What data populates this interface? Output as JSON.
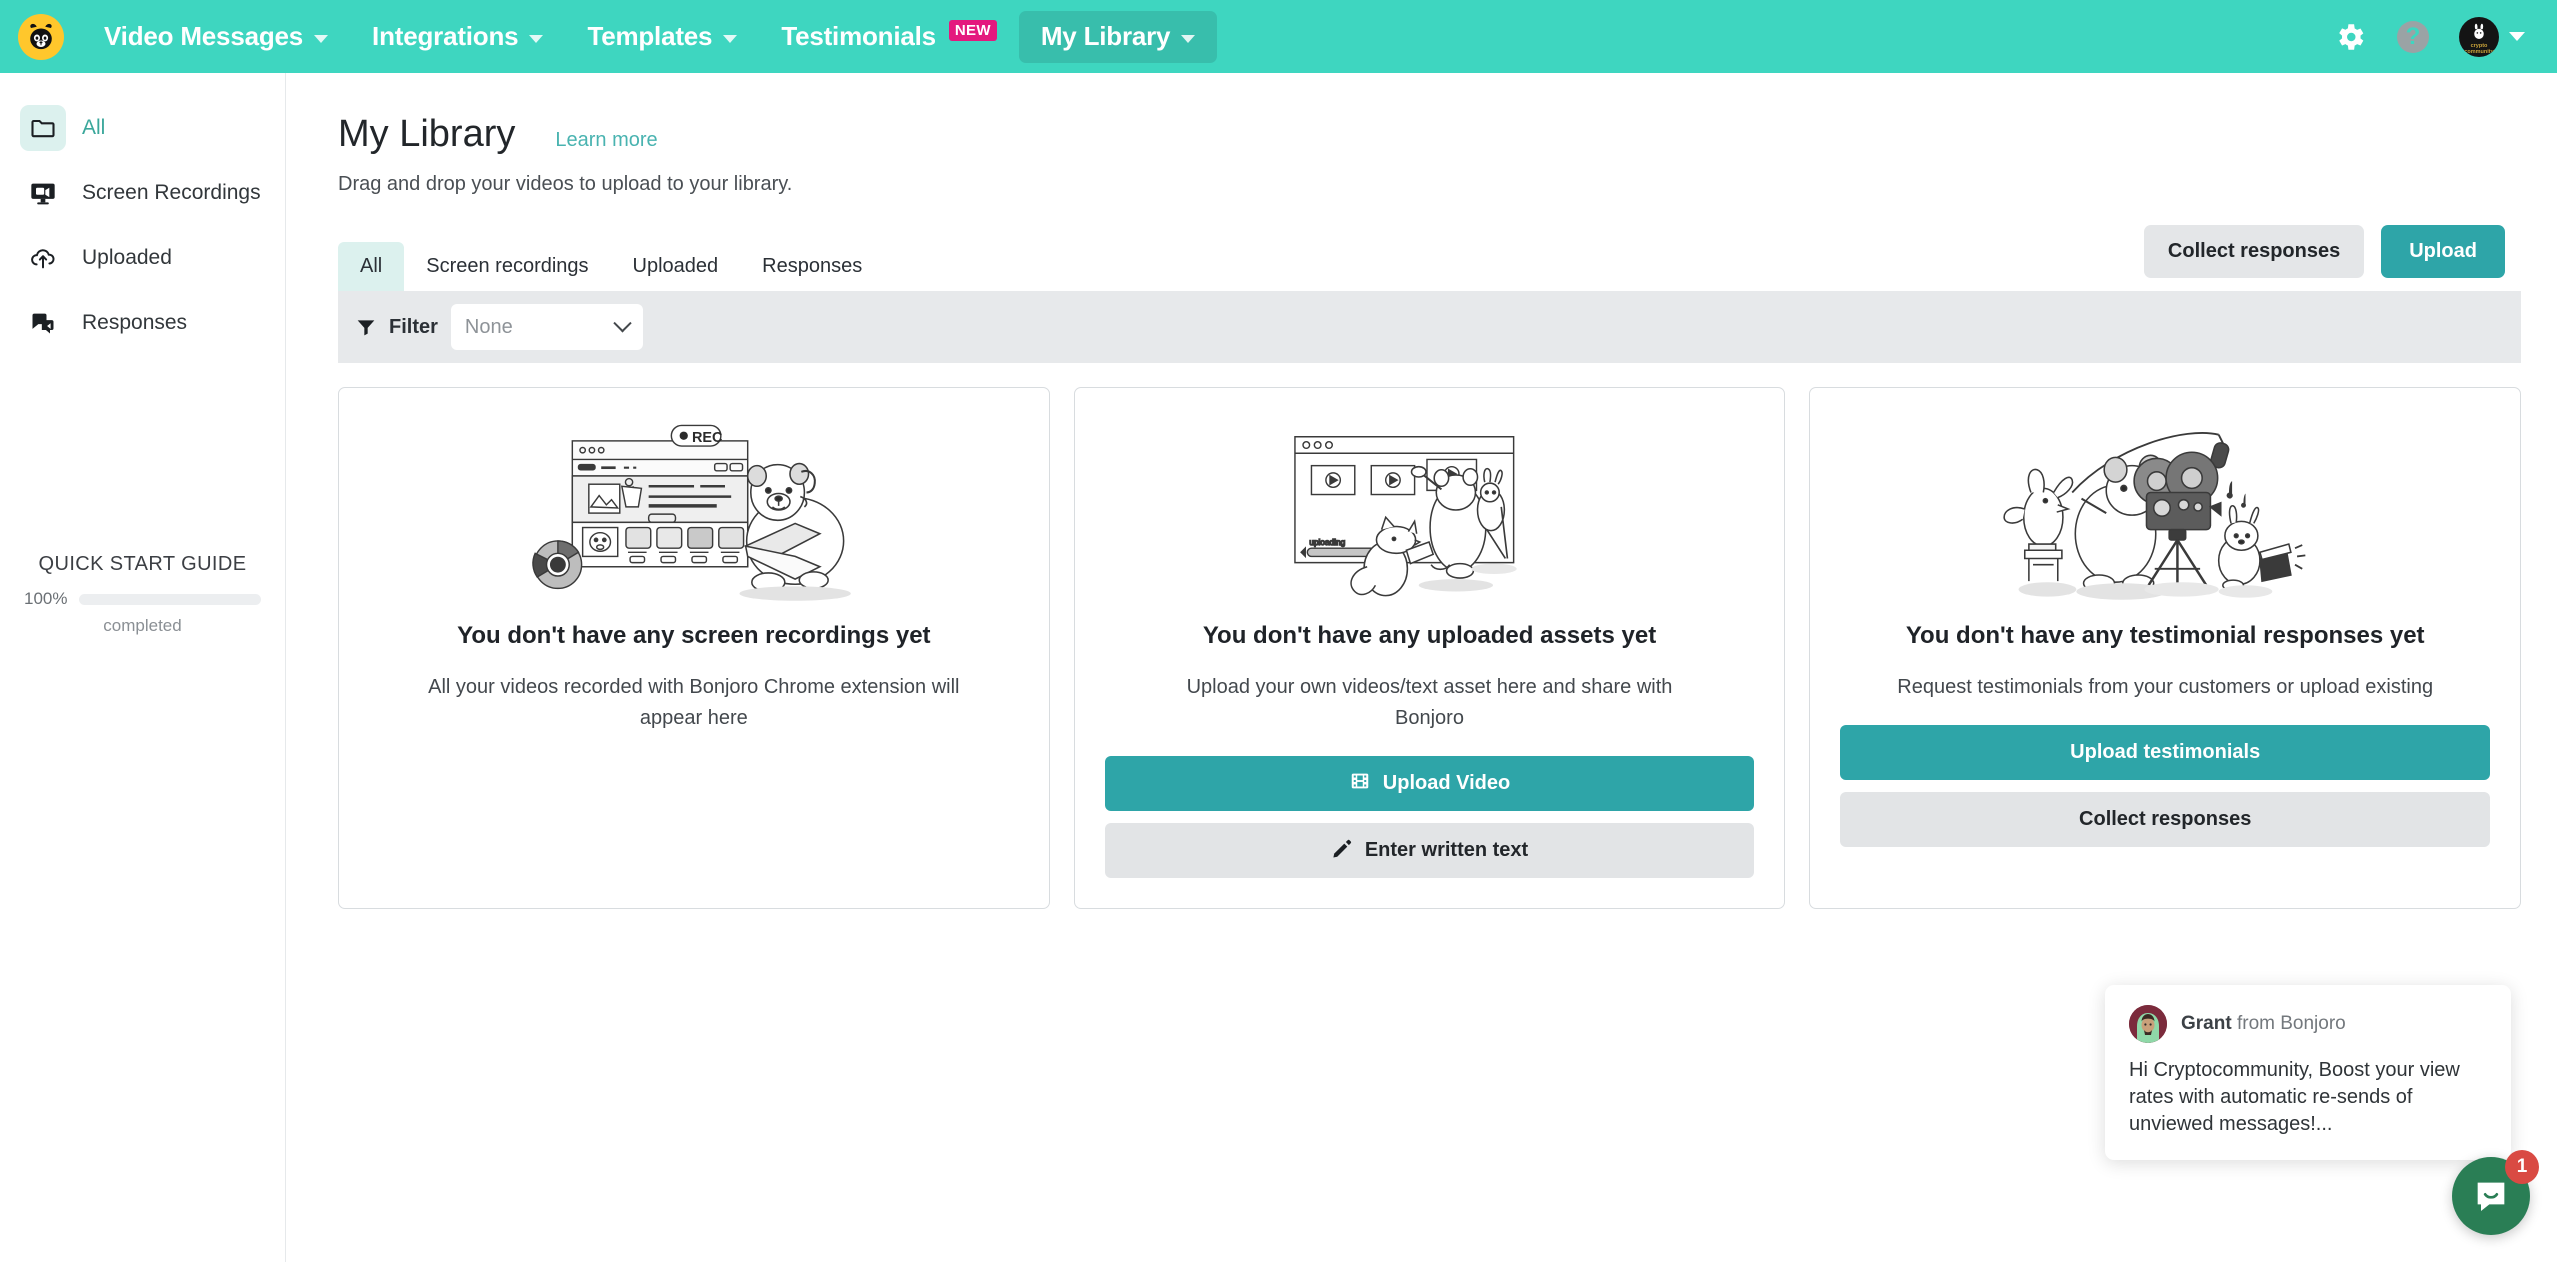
{
  "topnav": {
    "logo_name": "bonjoro-bear-logo",
    "items": [
      {
        "label": "Video Messages",
        "has_caret": true,
        "active": false
      },
      {
        "label": "Integrations",
        "has_caret": true,
        "active": false
      },
      {
        "label": "Templates",
        "has_caret": true,
        "active": false
      },
      {
        "label": "Testimonials",
        "has_caret": false,
        "active": false,
        "badge": "NEW"
      },
      {
        "label": "My Library",
        "has_caret": true,
        "active": true
      }
    ],
    "help_glyph": "?",
    "avatar_text_line1": "crypto",
    "avatar_text_line2": "community"
  },
  "sidebar": {
    "items": [
      {
        "label": "All",
        "icon": "folder-icon",
        "active": true
      },
      {
        "label": "Screen Recordings",
        "icon": "monitor-video-icon",
        "active": false
      },
      {
        "label": "Uploaded",
        "icon": "cloud-upload-icon",
        "active": false
      },
      {
        "label": "Responses",
        "icon": "chat-reply-icon",
        "active": false
      }
    ],
    "quickstart": {
      "title": "QUICK START GUIDE",
      "percent_label": "100%",
      "percent_value": 100,
      "completed_label": "completed",
      "bar_color": "#F9C527"
    }
  },
  "main": {
    "page_title": "My Library",
    "learn_more": "Learn more",
    "subtitle": "Drag and drop your videos to upload to your library.",
    "actions": {
      "collect_responses": "Collect responses",
      "upload": "Upload"
    },
    "tabs": [
      {
        "label": "All",
        "active": true
      },
      {
        "label": "Screen recordings",
        "active": false
      },
      {
        "label": "Uploaded",
        "active": false
      },
      {
        "label": "Responses",
        "active": false
      }
    ],
    "filter": {
      "label": "Filter",
      "value": "None",
      "icon": "funnel-icon"
    },
    "cards": [
      {
        "art": "screen-recording-illustration",
        "title": "You don't have any screen recordings yet",
        "desc": "All your videos recorded with Bonjoro Chrome extension will appear here",
        "buttons": []
      },
      {
        "art": "uploaded-assets-illustration",
        "title": "You don't have any uploaded assets yet",
        "desc": "Upload your own videos/text asset here and share with Bonjoro",
        "buttons": [
          {
            "label": "Upload Video",
            "style": "teal",
            "icon": "film-strip-icon"
          },
          {
            "label": "Enter written text",
            "style": "grey",
            "icon": "pencil-icon"
          }
        ]
      },
      {
        "art": "testimonial-filming-illustration",
        "title": "You don't have any testimonial responses yet",
        "desc": "Request testimonials from your customers or upload existing",
        "buttons": [
          {
            "label": "Upload testimonials",
            "style": "teal",
            "icon": ""
          },
          {
            "label": "Collect responses",
            "style": "grey",
            "icon": ""
          }
        ]
      }
    ]
  },
  "intercom": {
    "sender_name": "Grant",
    "sender_suffix": " from Bonjoro",
    "message": "Hi Cryptocommunity, Boost your view rates with automatic re-sends of unviewed messages!...",
    "launcher_badge": "1",
    "launcher_color": "#2A7E55",
    "badge_color": "#D94A43"
  },
  "colors": {
    "header_teal": "#3ED6C0",
    "active_nav_teal": "#38BEAC",
    "accent_teal": "#2EA5A8",
    "link_teal": "#49B3B0",
    "tab_active_bg": "#DCF1EE",
    "new_badge_pink": "#E4197E"
  }
}
